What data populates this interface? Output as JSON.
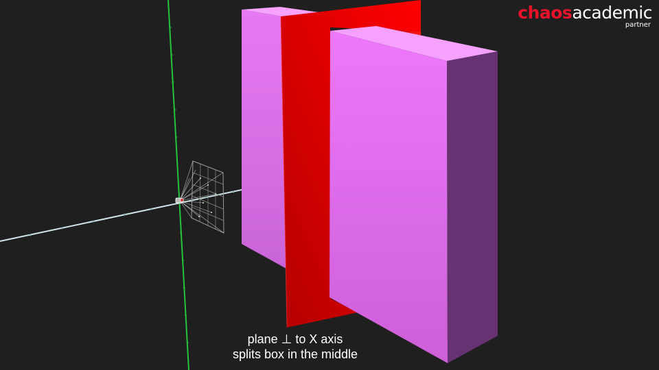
{
  "logo": {
    "brand": "chaos",
    "word": "academic",
    "sub": "partner"
  },
  "caption": {
    "line1": "plane ⊥ to X axis",
    "line2": "splits box in the middle"
  },
  "colors": {
    "background": "#1f1f1f",
    "box_front": "#e16ef0",
    "box_side": "#673272",
    "plane": "#d40000",
    "x_axis": "#cfe8ec",
    "y_axis": "#23c53a",
    "logo_red": "#e8132b"
  },
  "icons": {
    "camera": "camera-gizmo-icon"
  }
}
